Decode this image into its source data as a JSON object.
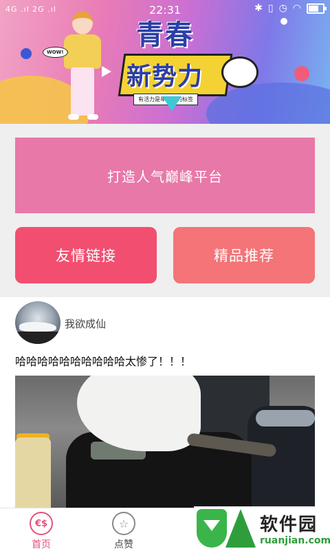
{
  "status_bar": {
    "network_left": "4G .ıl 2G .ıl",
    "time": "22:31",
    "icons": [
      "bluetooth-icon",
      "vibrate-icon",
      "alarm-icon",
      "wifi-icon",
      "battery-icon"
    ]
  },
  "banner": {
    "title_line1": "青春",
    "title_line2": "新势力",
    "tagline": "有活力是年轻人的标签",
    "sticker": "WOW!"
  },
  "hero_button": {
    "label": "打造人气巅峰平台",
    "color": "#e878a7"
  },
  "actions": [
    {
      "label": "友情链接",
      "color": "#f24f70"
    },
    {
      "label": "精品推荐",
      "color": "#f47478"
    }
  ],
  "post": {
    "username": "我欲成仙",
    "text": "哈哈哈哈哈哈哈哈哈哈太惨了！！！",
    "avatar_icon": "car-avatar",
    "image": "cat-on-rice-cooker-photo"
  },
  "bottom_nav": {
    "items": [
      {
        "label": "首页",
        "icon": "home-coins-icon",
        "active": true
      },
      {
        "label": "点赞",
        "icon": "star-icon",
        "active": false
      }
    ],
    "active_color": "#e94f7a"
  },
  "watermark": {
    "brand_cn": "软件园",
    "domain": "ruanjian.com"
  }
}
